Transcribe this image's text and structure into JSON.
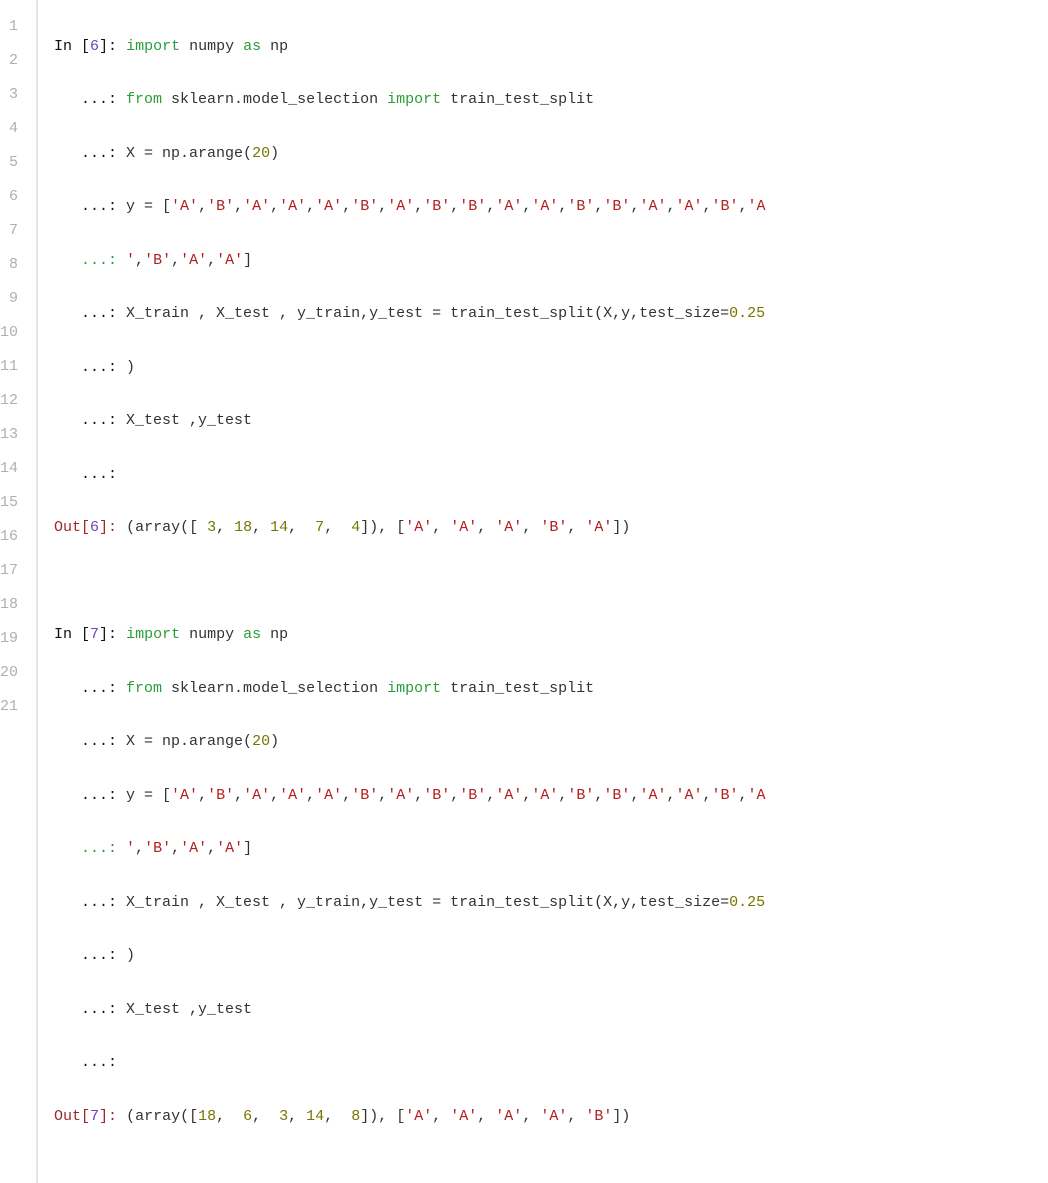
{
  "line_count": 21,
  "lines": {
    "1": "ln1",
    "2": "ln2",
    "3": "ln3",
    "4": "ln4",
    "5": "ln5",
    "6": "ln6",
    "7": "ln7",
    "8": "ln8",
    "9": "ln9",
    "10": "ln10",
    "11": "ln11",
    "12": "ln12",
    "13": "ln13",
    "14": "ln14",
    "15": "ln15",
    "16": "ln16",
    "17": "ln17",
    "18": "ln18",
    "19": "ln19",
    "20": "ln20",
    "21": "ln21"
  },
  "ln_labels": {
    "1": "1",
    "2": "2",
    "3": "3",
    "4": "4",
    "5": "5",
    "6": "6",
    "7": "7",
    "8": "8",
    "9": "9",
    "10": "10",
    "11": "11",
    "12": "12",
    "13": "13",
    "14": "14",
    "15": "15",
    "16": "16",
    "17": "17",
    "18": "18",
    "19": "19",
    "20": "20",
    "21": "21"
  },
  "t": {
    "In": "In [",
    "Out": "Out[",
    "close": "]: ",
    "cont": "   ...: ",
    "cont_bare": "   ...:",
    "import": "import",
    "as": "as",
    "from": "from",
    "numpy_np": " numpy ",
    "np_alias": " np",
    "sk_line": " sklearn.model_selection ",
    "tts": " train_test_split",
    "x_assign": "X = np.arange(",
    "twenty": "20",
    "close_paren": ")",
    "y_assign": "y = [",
    "A": "'A'",
    "B": "'B'",
    "comma": ",",
    "y_tail_open": "",
    "y_tail": "]",
    "split_call_a": "X_train , X_test , y_train,y_test = train_test_split(X,y,test_size=",
    "point25": "0.25",
    "xtest_line": "X_test ,y_test",
    "out6_a": "(array([ ",
    "o6_v1": "3",
    "o6_s": ", ",
    "o6_v2": "18",
    "o6_v3": "14",
    "o6_sp": ",  ",
    "o6_v4": "7",
    "o6_v5": "4",
    "out6_b": "]), [",
    "out6_c": "])",
    "out7_a": "(array([",
    "o7_v1": "18",
    "o7_v2": "6",
    "o7_v3": "3",
    "o7_v4": "14",
    "o7_v5": "8",
    "six": "6",
    "seven": "7"
  }
}
